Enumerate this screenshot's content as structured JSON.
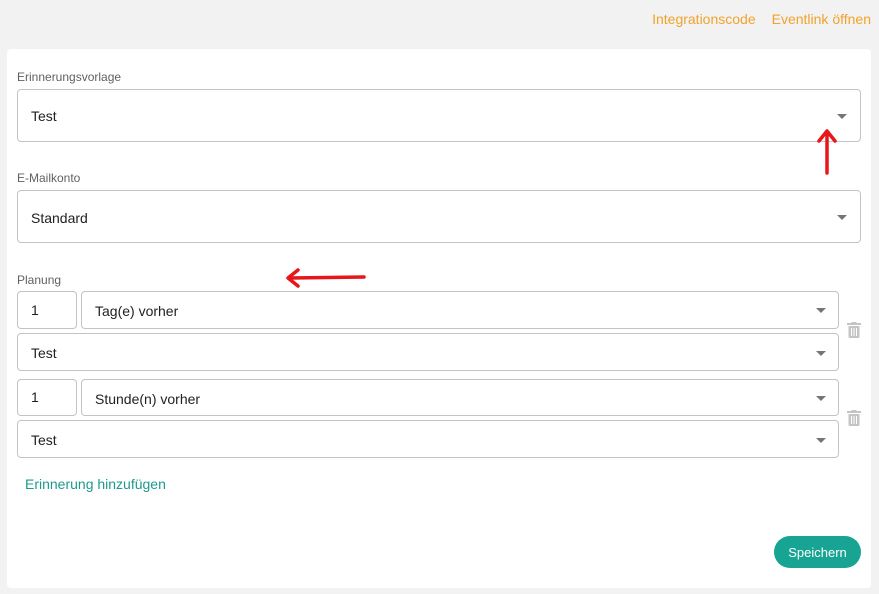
{
  "header": {
    "integration_label": "Integrationscode",
    "eventlink_label": "Eventlink öffnen"
  },
  "form": {
    "template": {
      "label": "Erinnerungsvorlage",
      "value": "Test"
    },
    "email_account": {
      "label": "E-Mailkonto",
      "value": "Standard"
    },
    "planning": {
      "label": "Planung",
      "entries": [
        {
          "amount": "1",
          "unit": "Tag(e) vorher",
          "template": "Test"
        },
        {
          "amount": "1",
          "unit": "Stunde(n) vorher",
          "template": "Test"
        }
      ]
    },
    "add_reminder_label": "Erinnerung hinzufügen",
    "save_label": "Speichern"
  },
  "colors": {
    "link_orange": "#f0a32b",
    "accent_teal": "#17a493",
    "annotation_red": "#e8161b"
  },
  "icons": [
    "dropdown-caret-icon",
    "trash-icon",
    "red-arrow-annotation"
  ]
}
